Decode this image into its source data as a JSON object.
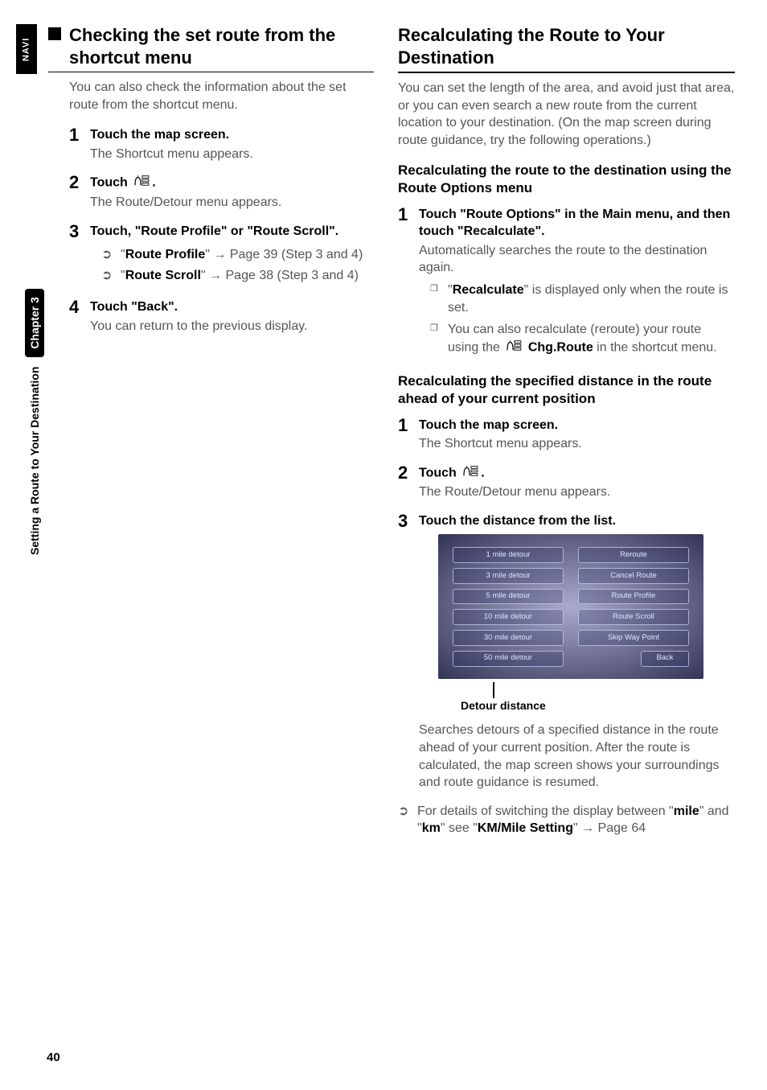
{
  "rail_label": "NAVI",
  "side_label_prefix": "Setting a Route to Your Destination",
  "side_label_chapter": "Chapter 3",
  "page_number": "40",
  "left": {
    "heading": "Checking the set route from the shortcut menu",
    "intro": "You can also check the information about the set route from the shortcut menu.",
    "steps": [
      {
        "num": "1",
        "bold": "Touch the map screen.",
        "after": "The Shortcut menu appears."
      },
      {
        "num": "2",
        "bold_pre": "Touch ",
        "bold_post": ".",
        "icon": true,
        "after": "The Route/Detour menu appears."
      },
      {
        "num": "3",
        "bold": "Touch, \"Route Profile\" or \"Route Scroll\"."
      },
      {
        "num": "4",
        "bold": "Touch \"Back\".",
        "after": "You can return to the previous display."
      }
    ],
    "sublinks": [
      {
        "label": "Route Profile",
        "tail": " → Page 39 (Step 3 and 4)"
      },
      {
        "label": "Route Scroll",
        "tail": " → Page 38 (Step 3 and 4)"
      }
    ]
  },
  "right": {
    "heading": "Recalculating the Route to Your Destination",
    "intro": "You can set the length of the area, and avoid just that area, or you can even search a new route from the current location to your destination. (On the map screen during route guidance, try the following operations.)",
    "sub1_heading": "Recalculating the route to the destination using the Route Options menu",
    "sub1_steps": [
      {
        "num": "1",
        "bold": "Touch \"Route Options\" in the Main menu, and then touch \"Recalculate\".",
        "after": "Automatically searches the route to the destination again."
      }
    ],
    "sub1_notes": [
      {
        "pre": "\"",
        "bold": "Recalculate",
        "post": "\" is displayed only when the route is set."
      },
      {
        "text_pre": "You can also recalculate (reroute) your route using the ",
        "bold": "Chg.Route",
        "text_post": " in the shortcut menu.",
        "icon": true
      }
    ],
    "sub2_heading": "Recalculating the specified distance in the route ahead of your current position",
    "sub2_steps": [
      {
        "num": "1",
        "bold": "Touch the map screen.",
        "after": "The Shortcut menu appears."
      },
      {
        "num": "2",
        "bold_pre": "Touch ",
        "bold_post": ".",
        "icon": true,
        "after": "The Route/Detour menu appears."
      },
      {
        "num": "3",
        "bold": "Touch the distance from the list."
      }
    ],
    "screenshot": {
      "left_buttons": [
        "1 mile detour",
        "3 mile detour",
        "5 mile detour",
        "10 mile detour",
        "30 mile detour",
        "50 mile detour"
      ],
      "right_buttons": [
        "Reroute",
        "Cancel Route",
        "Route Profile",
        "Route Scroll",
        "Skip Way Point",
        "Back"
      ],
      "caption": "Detour distance"
    },
    "after_shot": "Searches detours of a specified distance in the route ahead of your current position. After the route is calculated, the map screen shows your surroundings and route guidance is resumed.",
    "link_row": {
      "pre": "For details of switching the display between \"",
      "b1": "mile",
      "mid": "\" and \"",
      "b2": "km",
      "mid2": "\" see \"",
      "b3": "KM/Mile Setting",
      "tail": "\" → Page 64"
    }
  }
}
